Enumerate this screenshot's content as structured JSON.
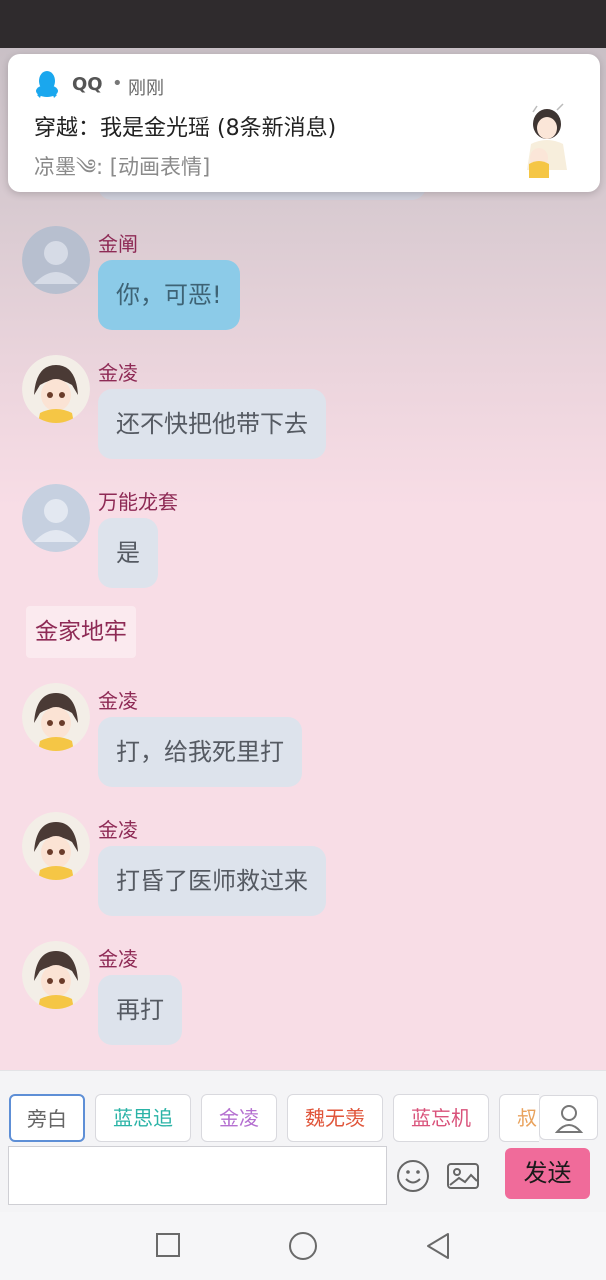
{
  "notification": {
    "app_name": "QQ",
    "separator": "•",
    "time": "刚刚",
    "title": "穿越：我是金光瑶 (8条新消息)",
    "body": "凉墨༄: [动画表情]"
  },
  "messages": [
    {
      "sender": "金阐",
      "text": "你，可恶!",
      "avatar": "default-avatar",
      "style": "blue"
    },
    {
      "sender": "金凌",
      "text": "还不快把他带下去",
      "avatar": "anime-avatar",
      "style": "gray"
    },
    {
      "sender": "万能龙套",
      "text": "是",
      "avatar": "default-avatar",
      "style": "gray"
    },
    {
      "sender": "金凌",
      "text": "打，给我死里打",
      "avatar": "anime-avatar",
      "style": "gray"
    },
    {
      "sender": "金凌",
      "text": "打昏了医师救过来",
      "avatar": "anime-avatar",
      "style": "gray"
    },
    {
      "sender": "金凌",
      "text": "再打",
      "avatar": "anime-avatar",
      "style": "gray"
    }
  ],
  "narration": "金家地牢",
  "characters": [
    {
      "label": "旁白",
      "color": "#666666"
    },
    {
      "label": "蓝思追",
      "color": "#2ab3a6"
    },
    {
      "label": "金凌",
      "color": "#b46fd0"
    },
    {
      "label": "魏无羡",
      "color": "#e0553a"
    },
    {
      "label": "蓝忘机",
      "color": "#d9537b"
    },
    {
      "label": "叔",
      "color": "#e9a25c"
    }
  ],
  "input": {
    "value": "",
    "placeholder": ""
  },
  "send_label": "发送",
  "colors": {
    "sender_name": "#8e2a55",
    "send_button": "#f06b9a",
    "active_chip_border": "#5e8fd6",
    "qq_blue": "#1aa7ee"
  },
  "icons": [
    "qq-icon",
    "profile-icon",
    "emoji-icon",
    "image-icon",
    "square-recent-icon",
    "circle-home-icon",
    "triangle-back-icon"
  ]
}
